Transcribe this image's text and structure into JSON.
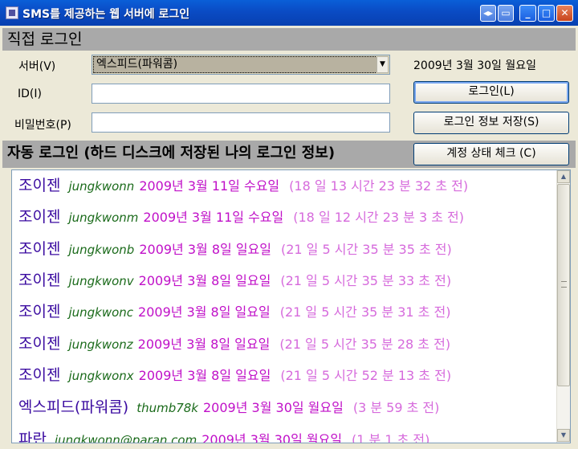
{
  "window": {
    "title": "SMS를 제공하는 웹 서버에 로그인"
  },
  "direct_login": {
    "header": "직접 로그인",
    "server_label": "서버(V)",
    "server_value": "엑스피드(파워콤)",
    "id_label": "ID(I)",
    "id_value": "",
    "password_label": "비밀번호(P)",
    "password_value": "",
    "date": "2009년 3월 30일 월요일",
    "login_button": "로그인(L)",
    "save_button": "로그인 정보 저장(S)"
  },
  "auto_login": {
    "header": "자동 로그인 (하드 디스크에 저장된 나의 로그인 정보)",
    "check_button": "계정 상태 체크 (C)",
    "entries": [
      {
        "service": "조이젠",
        "user": "jungkwonn",
        "date": "2009년 3월 11일 수요일",
        "ago": "(18 일 13 시간 23 분 32 초 전)"
      },
      {
        "service": "조이젠",
        "user": "jungkwonm",
        "date": "2009년 3월 11일 수요일",
        "ago": "(18 일 12 시간 23 분 3 초 전)"
      },
      {
        "service": "조이젠",
        "user": "jungkwonb",
        "date": "2009년 3월 8일 일요일",
        "ago": "(21 일 5 시간 35 분 35 초 전)"
      },
      {
        "service": "조이젠",
        "user": "jungkwonv",
        "date": "2009년 3월 8일 일요일",
        "ago": "(21 일 5 시간 35 분 33 초 전)"
      },
      {
        "service": "조이젠",
        "user": "jungkwonc",
        "date": "2009년 3월 8일 일요일",
        "ago": "(21 일 5 시간 35 분 31 초 전)"
      },
      {
        "service": "조이젠",
        "user": "jungkwonz",
        "date": "2009년 3월 8일 일요일",
        "ago": "(21 일 5 시간 35 분 28 초 전)"
      },
      {
        "service": "조이젠",
        "user": "jungkwonx",
        "date": "2009년 3월 8일 일요일",
        "ago": "(21 일 5 시간 52 분 13 초 전)"
      },
      {
        "service": "엑스피드(파워콤)",
        "user": "thumb78k",
        "date": "2009년 3월 30일 월요일",
        "ago": "(3 분 59 초 전)"
      },
      {
        "service": "파란",
        "user": "jungkwonn@paran.com",
        "date": "2009년 3월 30일 월요일",
        "ago": "(1 분 1 초 전)"
      }
    ]
  },
  "icons": {
    "app": "app-icon",
    "restore": "restore-icon",
    "tray": "tray-icon",
    "minimize": "minimize-icon",
    "maximize": "maximize-icon",
    "close": "close-icon",
    "dropdown": "chevron-down-icon",
    "scroll_up": "scroll-up-icon",
    "scroll_down": "scroll-down-icon"
  },
  "colors": {
    "service": "#3a0aa0",
    "user": "#1a6a1a",
    "date": "#c010c8",
    "ago": "#d66adc",
    "header_bg": "#a9a9a9",
    "titlebar": "#0a4bc4"
  }
}
